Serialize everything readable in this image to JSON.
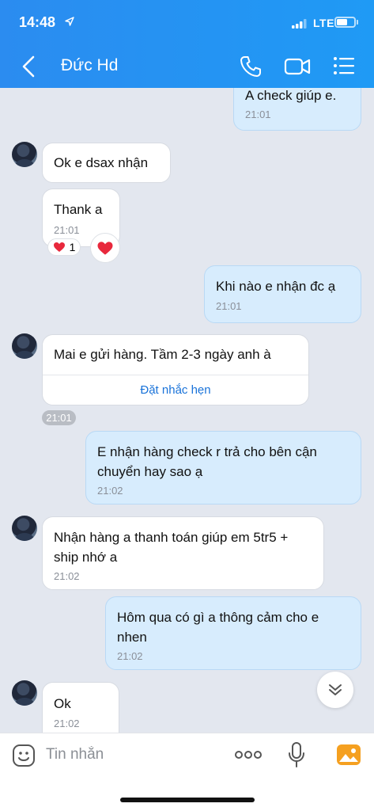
{
  "status_bar": {
    "time": "14:48",
    "network": "LTE",
    "battery_level": 0.6
  },
  "header": {
    "contact_name": "Đức Hd"
  },
  "colors": {
    "header_blue": "#2b8cf0",
    "outgoing_bubble": "#d7ecfd",
    "link_blue": "#1a73d9",
    "heart_red": "#e8283c"
  },
  "messages": [
    {
      "from": "me",
      "text": "A check giúp e.",
      "time": "21:01"
    },
    {
      "from": "contact",
      "text": "Ok e dsax nhận",
      "time": ""
    },
    {
      "from": "contact",
      "text": "Thank a",
      "time": "21:01",
      "reaction": {
        "icon": "heart-icon",
        "count": "1"
      }
    },
    {
      "from": "me",
      "text": "Khi nào e nhận đc ạ",
      "time": "21:01"
    },
    {
      "from": "contact",
      "text": "Mai e gửi hàng. Tầm 2-3 ngày anh à",
      "action": "Đặt nhắc hẹn"
    },
    {
      "from": "system",
      "text": "21:01"
    },
    {
      "from": "me",
      "text": "E nhận hàng check r trả cho bên cận chuyển hay sao ạ",
      "time": "21:02"
    },
    {
      "from": "contact",
      "text": "Nhận hàng a thanh toán giúp em 5tr5 + ship nhớ a",
      "time": "21:02"
    },
    {
      "from": "me",
      "text": "Hôm qua có gì a thông cảm cho e nhen",
      "time": "21:02"
    },
    {
      "from": "contact",
      "text": "Ok",
      "time": "21:02"
    }
  ],
  "input": {
    "placeholder": "Tin nhắn"
  }
}
